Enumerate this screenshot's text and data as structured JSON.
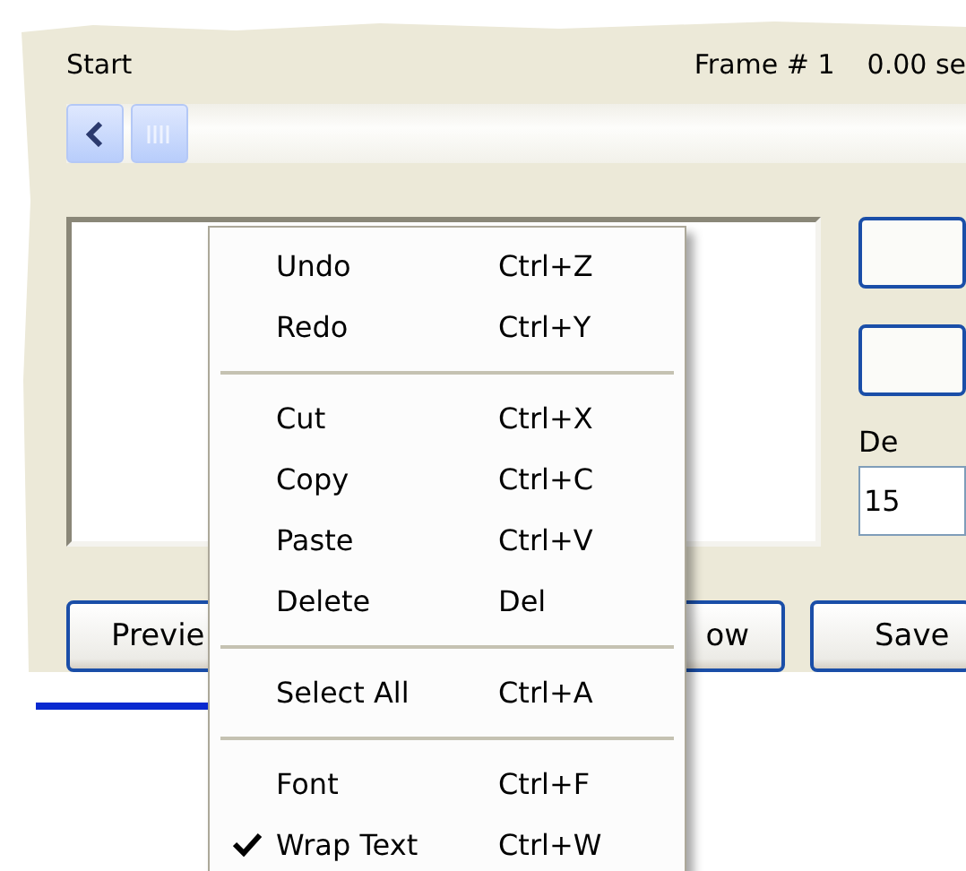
{
  "header": {
    "start_label": "Start",
    "frame_label": "Frame # 1",
    "time_label": "0.00 se"
  },
  "side_panel": {
    "label": "De",
    "value": "15"
  },
  "buttons": [
    "Previe",
    "ow",
    "Save"
  ],
  "context_menu": [
    {
      "kind": "item",
      "label": "Undo",
      "shortcut": "Ctrl+Z",
      "checked": false
    },
    {
      "kind": "item",
      "label": "Redo",
      "shortcut": "Ctrl+Y",
      "checked": false
    },
    {
      "kind": "separator"
    },
    {
      "kind": "item",
      "label": "Cut",
      "shortcut": "Ctrl+X",
      "checked": false
    },
    {
      "kind": "item",
      "label": "Copy",
      "shortcut": "Ctrl+C",
      "checked": false
    },
    {
      "kind": "item",
      "label": "Paste",
      "shortcut": "Ctrl+V",
      "checked": false
    },
    {
      "kind": "item",
      "label": "Delete",
      "shortcut": "Del",
      "checked": false
    },
    {
      "kind": "separator"
    },
    {
      "kind": "item",
      "label": "Select All",
      "shortcut": "Ctrl+A",
      "checked": false
    },
    {
      "kind": "separator"
    },
    {
      "kind": "item",
      "label": "Font",
      "shortcut": "Ctrl+F",
      "checked": false
    },
    {
      "kind": "item",
      "label": "Wrap Text",
      "shortcut": "Ctrl+W",
      "checked": true
    }
  ]
}
